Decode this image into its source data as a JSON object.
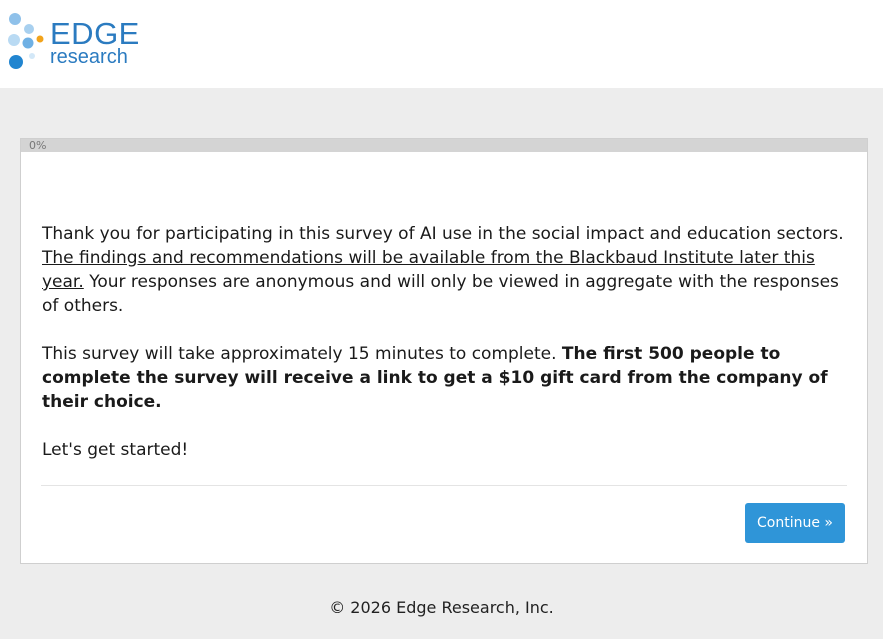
{
  "brand": {
    "name": "EDGE",
    "subname": "research",
    "logo_icon": "dots-logo-icon",
    "color": "#2b7bc0"
  },
  "progress": {
    "label": "0%",
    "value": 0
  },
  "intro": {
    "p1_text": "Thank you for participating in this survey of AI use in the social impact and education sectors.",
    "p1_link": "The findings and recommendations will be available from the Blackbaud Institute later this year.",
    "p1_rest": "Your responses are anonymous and will only be viewed in aggregate with the responses of others.",
    "p2_text": "This survey will take approximately 15 minutes to complete.",
    "p2_bold": "The first 500 people to complete the survey will receive a link to get a $10 gift card from the company of their choice.",
    "p3_text": "Let's get started!"
  },
  "actions": {
    "continue_label": "Continue »",
    "button_color": "#2f95d8"
  },
  "footer": {
    "copyright": "© 2026 Edge Research, Inc."
  }
}
